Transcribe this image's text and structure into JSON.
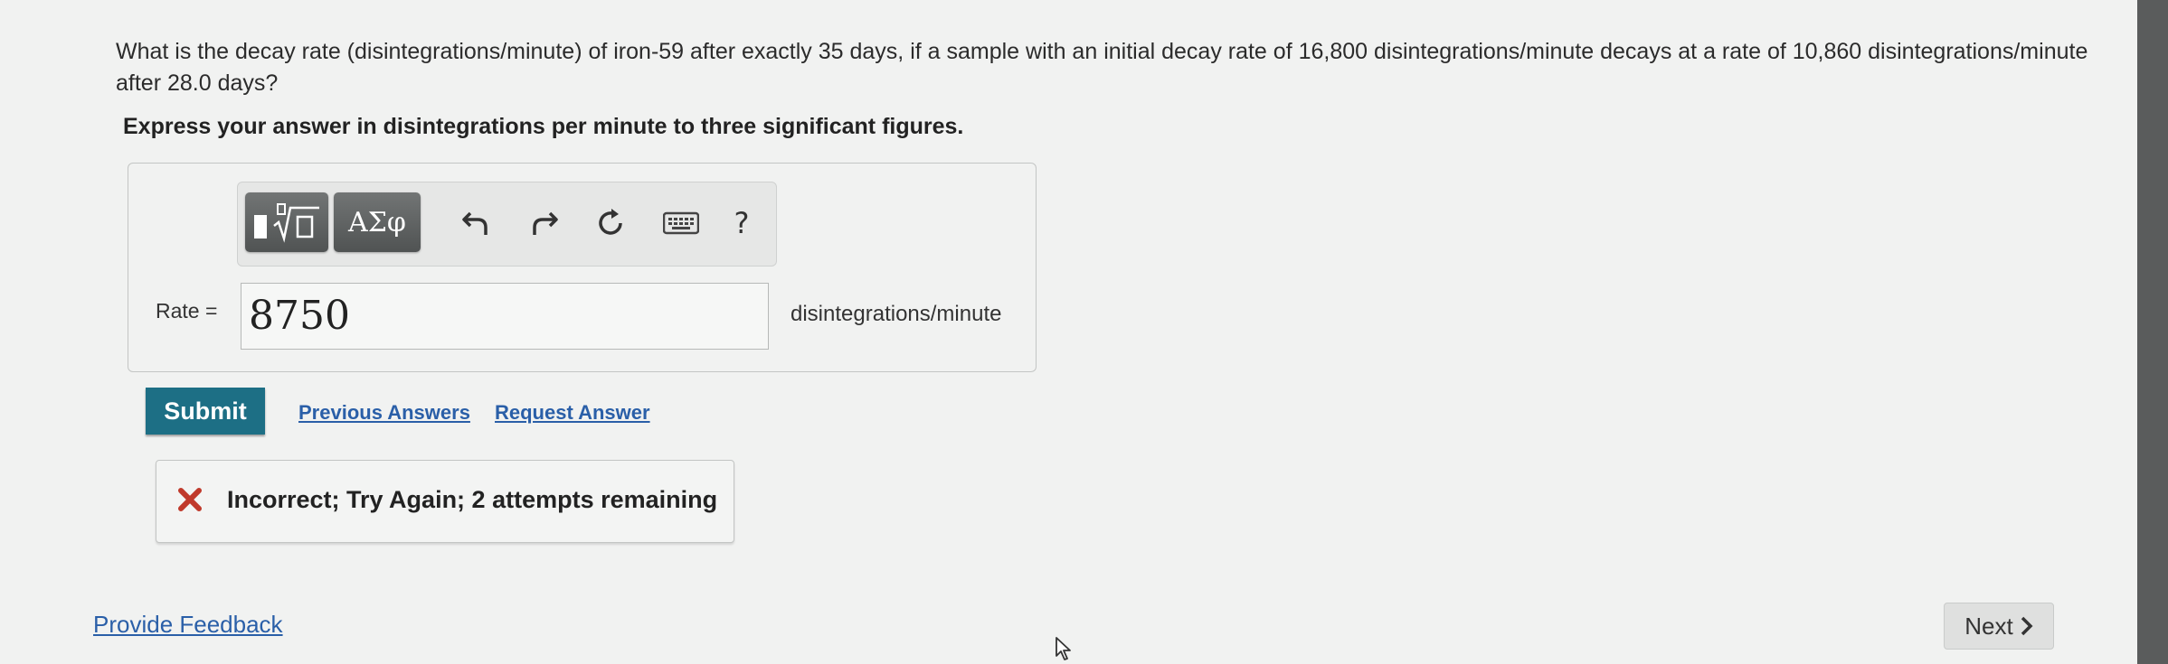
{
  "question": {
    "text": "What is the decay rate (disintegrations/minute) of iron-59 after exactly 35 days, if a sample with an initial decay rate of 16,800 disintegrations/minute decays at a rate of 10,860 disintegrations/minute after 28.0 days?",
    "instruction": "Express your answer in disintegrations per minute to three significant figures."
  },
  "toolbar": {
    "templates_icon": "templates-radical-icon",
    "symbols_label": "ΑΣφ",
    "undo_icon": "undo-icon",
    "redo_icon": "redo-icon",
    "reset_icon": "reset-icon",
    "keyboard_icon": "keyboard-icon",
    "help_label": "?"
  },
  "answer": {
    "label": "Rate =",
    "value": "8750",
    "units": "disintegrations/minute"
  },
  "actions": {
    "submit_label": "Submit",
    "previous_answers": "Previous Answers",
    "request_answer": "Request Answer"
  },
  "feedback": {
    "status_icon": "x-mark-icon",
    "message": "Incorrect; Try Again; 2 attempts remaining",
    "status_color": "#c0392b"
  },
  "footer": {
    "provide_feedback": "Provide Feedback",
    "next_label": "Next"
  },
  "colors": {
    "submit": "#1d6f85",
    "link": "#2a5fa8",
    "background": "#f1f2f1"
  }
}
